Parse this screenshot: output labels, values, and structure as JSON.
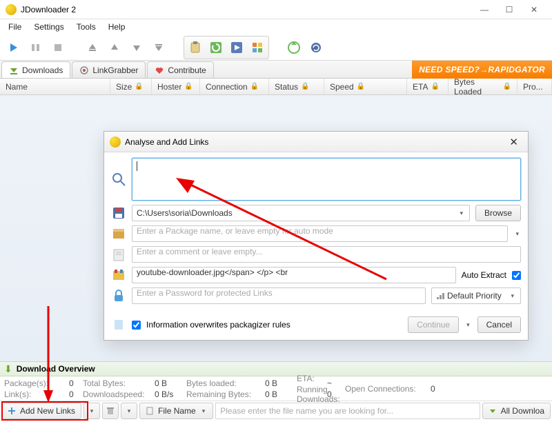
{
  "window": {
    "title": "JDownloader 2"
  },
  "menu": {
    "file": "File",
    "settings": "Settings",
    "tools": "Tools",
    "help": "Help"
  },
  "tabs": {
    "downloads": "Downloads",
    "linkgrabber": "LinkGrabber",
    "contribute": "Contribute"
  },
  "banner": {
    "text": "NEED SPEED?→RAPIDGATOR"
  },
  "columns": {
    "name": "Name",
    "size": "Size",
    "hoster": "Hoster",
    "connection": "Connection",
    "status": "Status",
    "speed": "Speed",
    "eta": "ETA",
    "bytes_loaded": "Bytes Loaded",
    "pro": "Pro..."
  },
  "overview": {
    "title": "Download Overview"
  },
  "stats": {
    "packages_lbl": "Package(s):",
    "packages_val": "0",
    "links_lbl": "Link(s):",
    "links_val": "0",
    "total_bytes_lbl": "Total Bytes:",
    "total_bytes_val": "0 B",
    "dlspeed_lbl": "Downloadspeed:",
    "dlspeed_val": "0 B/s",
    "bytes_loaded_lbl": "Bytes loaded:",
    "bytes_loaded_val": "0 B",
    "remaining_lbl": "Remaining Bytes:",
    "remaining_val": "0 B",
    "eta_lbl": "ETA:",
    "eta_val": "~",
    "running_lbl": "Running Downloads:",
    "running_val": "0",
    "open_conn_lbl": "Open Connections:",
    "open_conn_val": "0"
  },
  "bottom": {
    "add_links": "Add New Links",
    "filename_lbl": "File Name",
    "search_placeholder": "Please enter the file name you are looking for...",
    "all_downloads": "All Downloa"
  },
  "dialog": {
    "title": "Analyse and Add Links",
    "links_value": "",
    "path": "C:\\Users\\soria\\Downloads",
    "browse": "Browse",
    "pkg_placeholder": "Enter a Package name, or leave empty for auto mode",
    "comment_placeholder": "Enter a comment or leave empty...",
    "archive_value": "youtube-downloader.jpg</span> </p> <br",
    "auto_extract": "Auto Extract",
    "password_placeholder": "Enter a Password for protected Links",
    "priority": "Default Priority",
    "overwrite_label": "Information overwrites packagizer rules",
    "continue": "Continue",
    "cancel": "Cancel"
  }
}
